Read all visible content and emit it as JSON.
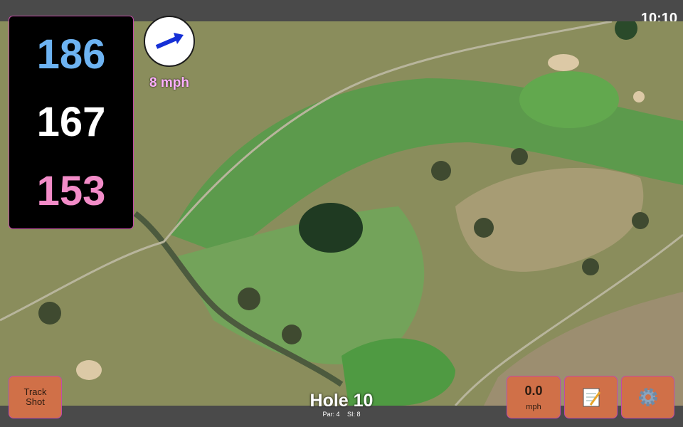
{
  "status_bar": {
    "time": "10:10"
  },
  "distances": {
    "back": "186",
    "middle": "167",
    "front": "153"
  },
  "colors": {
    "back": "#6db3f2",
    "middle": "#ffffff",
    "front": "#f28cc8",
    "accent": "#d07048",
    "border": "#c24aa6"
  },
  "wind": {
    "speed": "8 mph",
    "direction_icon": "arrow-icon"
  },
  "hole": {
    "title": "Hole 10",
    "par": "Par: 4",
    "si": "SI: 8"
  },
  "buttons": {
    "track_shot": "Track\nShot",
    "speed_value": "0.0",
    "speed_unit": "mph",
    "notes_icon": "notepad-icon",
    "settings_icon": "gear-icon"
  }
}
